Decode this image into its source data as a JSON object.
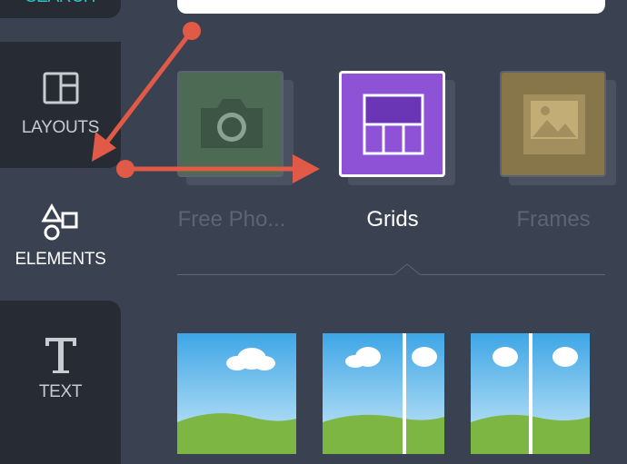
{
  "sidebar": {
    "search_label": "SEARCH",
    "items": [
      {
        "label": "LAYOUTS",
        "icon": "layouts-icon",
        "active": false
      },
      {
        "label": "ELEMENTS",
        "icon": "elements-icon",
        "active": true
      },
      {
        "label": "TEXT",
        "icon": "text-icon",
        "active": false
      }
    ]
  },
  "categories": [
    {
      "label": "Free Pho...",
      "icon": "camera-icon",
      "selected": false
    },
    {
      "label": "Grids",
      "icon": "grid-icon",
      "selected": true
    },
    {
      "label": "Frames",
      "icon": "photo-frame-icon",
      "selected": false
    }
  ],
  "annotations": {
    "color": "#e05a47"
  },
  "colors": {
    "sidebar_dark": "#272b33",
    "panel": "#3a4150",
    "accent_purple": "#8d52d6",
    "search_teal": "#2ec4c4"
  }
}
